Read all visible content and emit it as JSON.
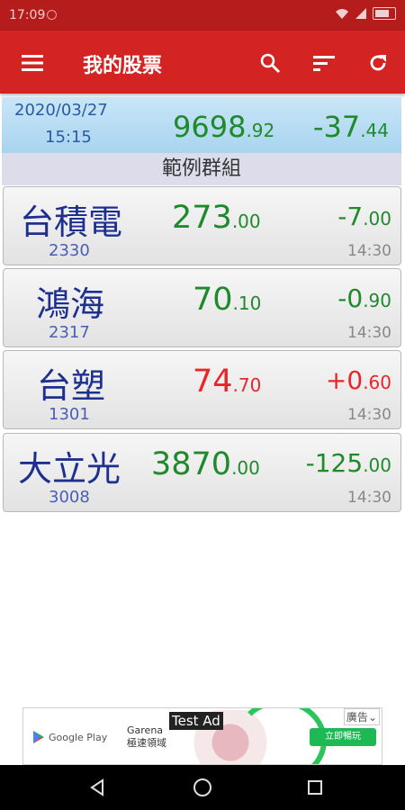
{
  "status": {
    "time": "17:09"
  },
  "appbar": {
    "title": "我的股票"
  },
  "summary": {
    "date": "2020/03/27",
    "time": "15:15",
    "index_main": "9698",
    "index_dec": ".92",
    "change_main": "-37",
    "change_dec": ".44"
  },
  "group": {
    "name": "範例群組"
  },
  "stocks": [
    {
      "name": "台積電",
      "code": "2330",
      "price_main": "273",
      "price_dec": ".00",
      "change_main": "-7",
      "change_dec": ".00",
      "time": "14:30",
      "color": "#1f8a2c"
    },
    {
      "name": "鴻海",
      "code": "2317",
      "price_main": "70",
      "price_dec": ".10",
      "change_main": "-0",
      "change_dec": ".90",
      "time": "14:30",
      "color": "#1f8a2c"
    },
    {
      "name": "台塑",
      "code": "1301",
      "price_main": "74",
      "price_dec": ".70",
      "change_main": "+0",
      "change_dec": ".60",
      "time": "14:30",
      "color": "#e8262a"
    },
    {
      "name": "大立光",
      "code": "3008",
      "price_main": "3870",
      "price_dec": ".00",
      "change_main": "-125",
      "change_dec": ".00",
      "time": "14:30",
      "color": "#1f8a2c"
    }
  ],
  "ad": {
    "google_play": "Google Play",
    "brand_line1": "Garena",
    "brand_line2": "極速領域",
    "cta": "立即暢玩",
    "label": "廣告",
    "test_label": "Test Ad"
  },
  "icons": {
    "menu": "menu-icon",
    "search": "search-icon",
    "sort": "sort-icon",
    "refresh": "refresh-icon"
  },
  "colors": {
    "appbar": "#d32323",
    "statusbar": "#b51d1d",
    "down": "#1f8a2c",
    "up": "#e8262a"
  }
}
